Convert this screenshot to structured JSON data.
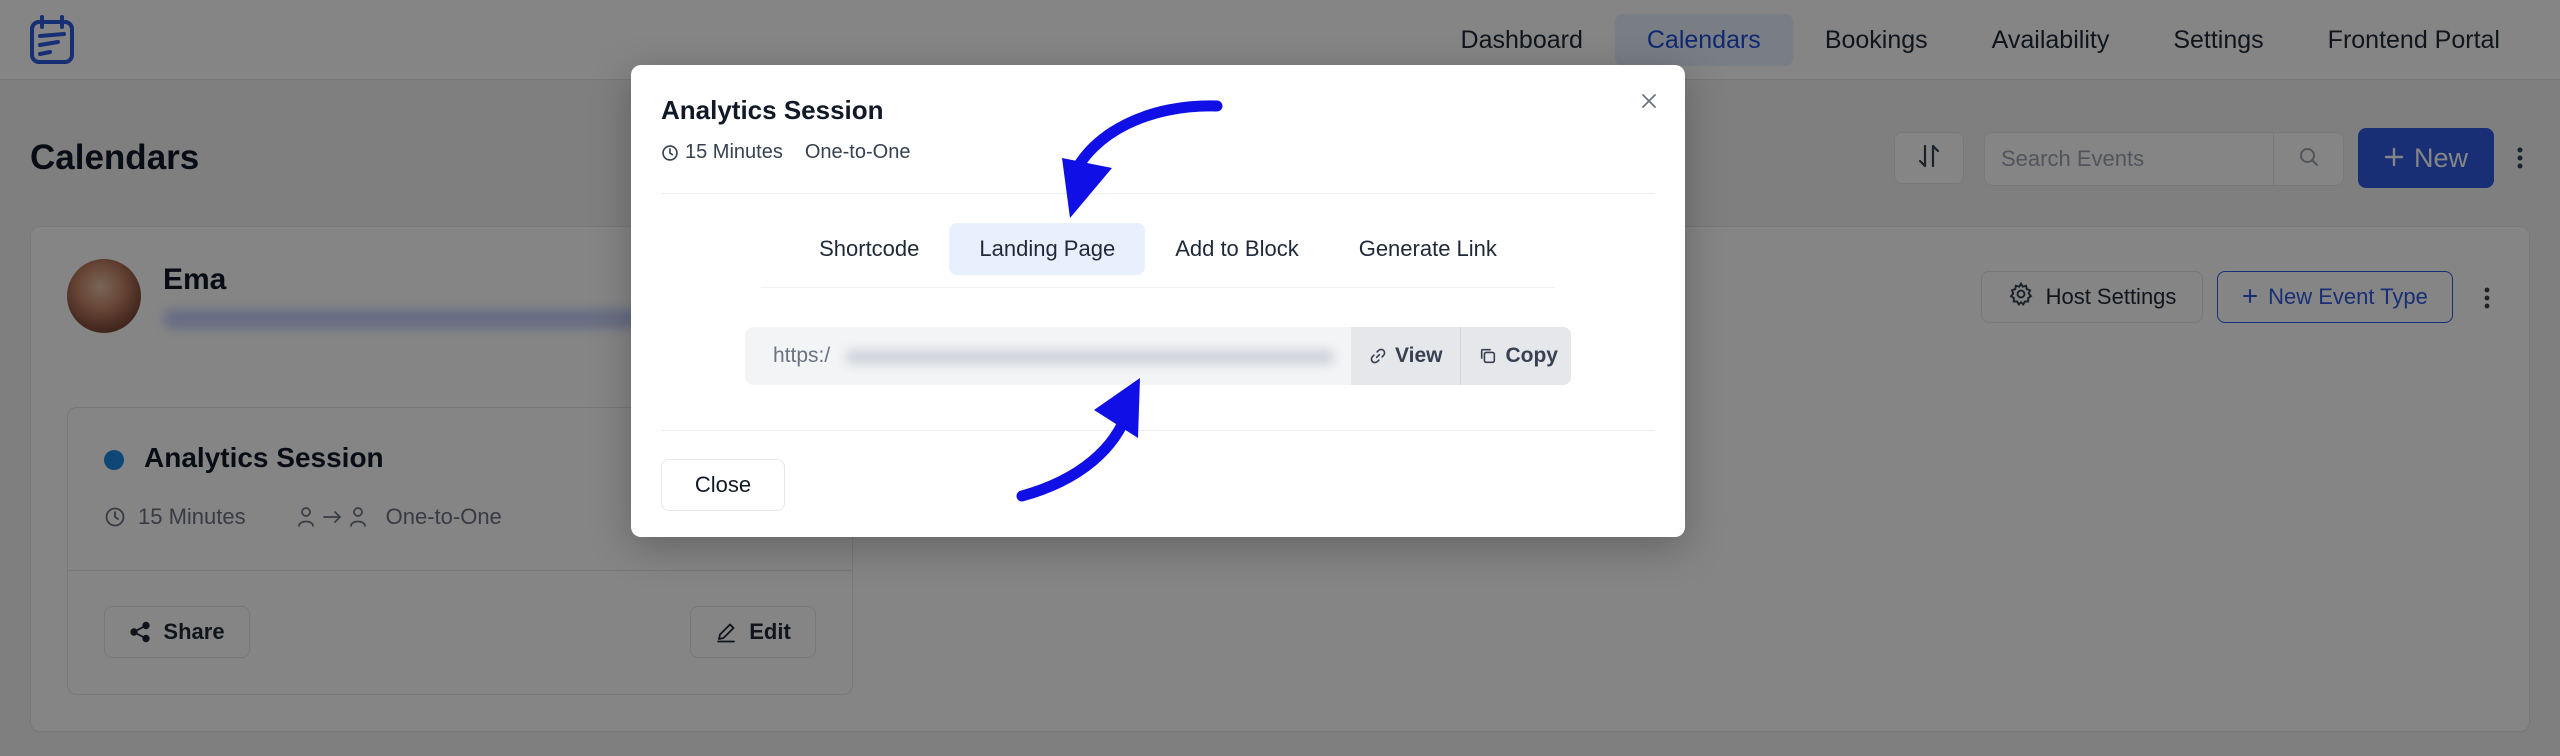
{
  "nav": {
    "items": [
      {
        "label": "Dashboard",
        "active": false
      },
      {
        "label": "Calendars",
        "active": true
      },
      {
        "label": "Bookings",
        "active": false
      },
      {
        "label": "Availability",
        "active": false
      },
      {
        "label": "Settings",
        "active": false
      },
      {
        "label": "Frontend Portal",
        "active": false
      }
    ]
  },
  "page": {
    "title": "Calendars",
    "search_placeholder": "Search Events",
    "new_label": "New"
  },
  "host": {
    "name": "Ema",
    "host_settings_label": "Host Settings",
    "new_event_type_label": "New Event Type"
  },
  "event": {
    "title": "Analytics Session",
    "duration": "15 Minutes",
    "type": "One-to-One",
    "share_label": "Share",
    "edit_label": "Edit",
    "dot_color": "#1e88e5"
  },
  "modal": {
    "title": "Analytics Session",
    "duration": "15 Minutes",
    "type": "One-to-One",
    "tabs": [
      {
        "label": "Shortcode",
        "active": false
      },
      {
        "label": "Landing Page",
        "active": true
      },
      {
        "label": "Add to Block",
        "active": false
      },
      {
        "label": "Generate Link",
        "active": false
      }
    ],
    "url_prefix": "https:/",
    "view_label": "View",
    "copy_label": "Copy",
    "close_label": "Close"
  },
  "colors": {
    "accent": "#2f5be0",
    "annotation_arrow": "#1010e6"
  },
  "icons": [
    "logo-icon",
    "sort-icon",
    "search-icon",
    "plus-icon",
    "kebab-icon",
    "gear-icon",
    "clock-icon",
    "user-to-user-icon",
    "share-icon",
    "edit-icon",
    "close-icon",
    "link-icon",
    "copy-icon"
  ]
}
